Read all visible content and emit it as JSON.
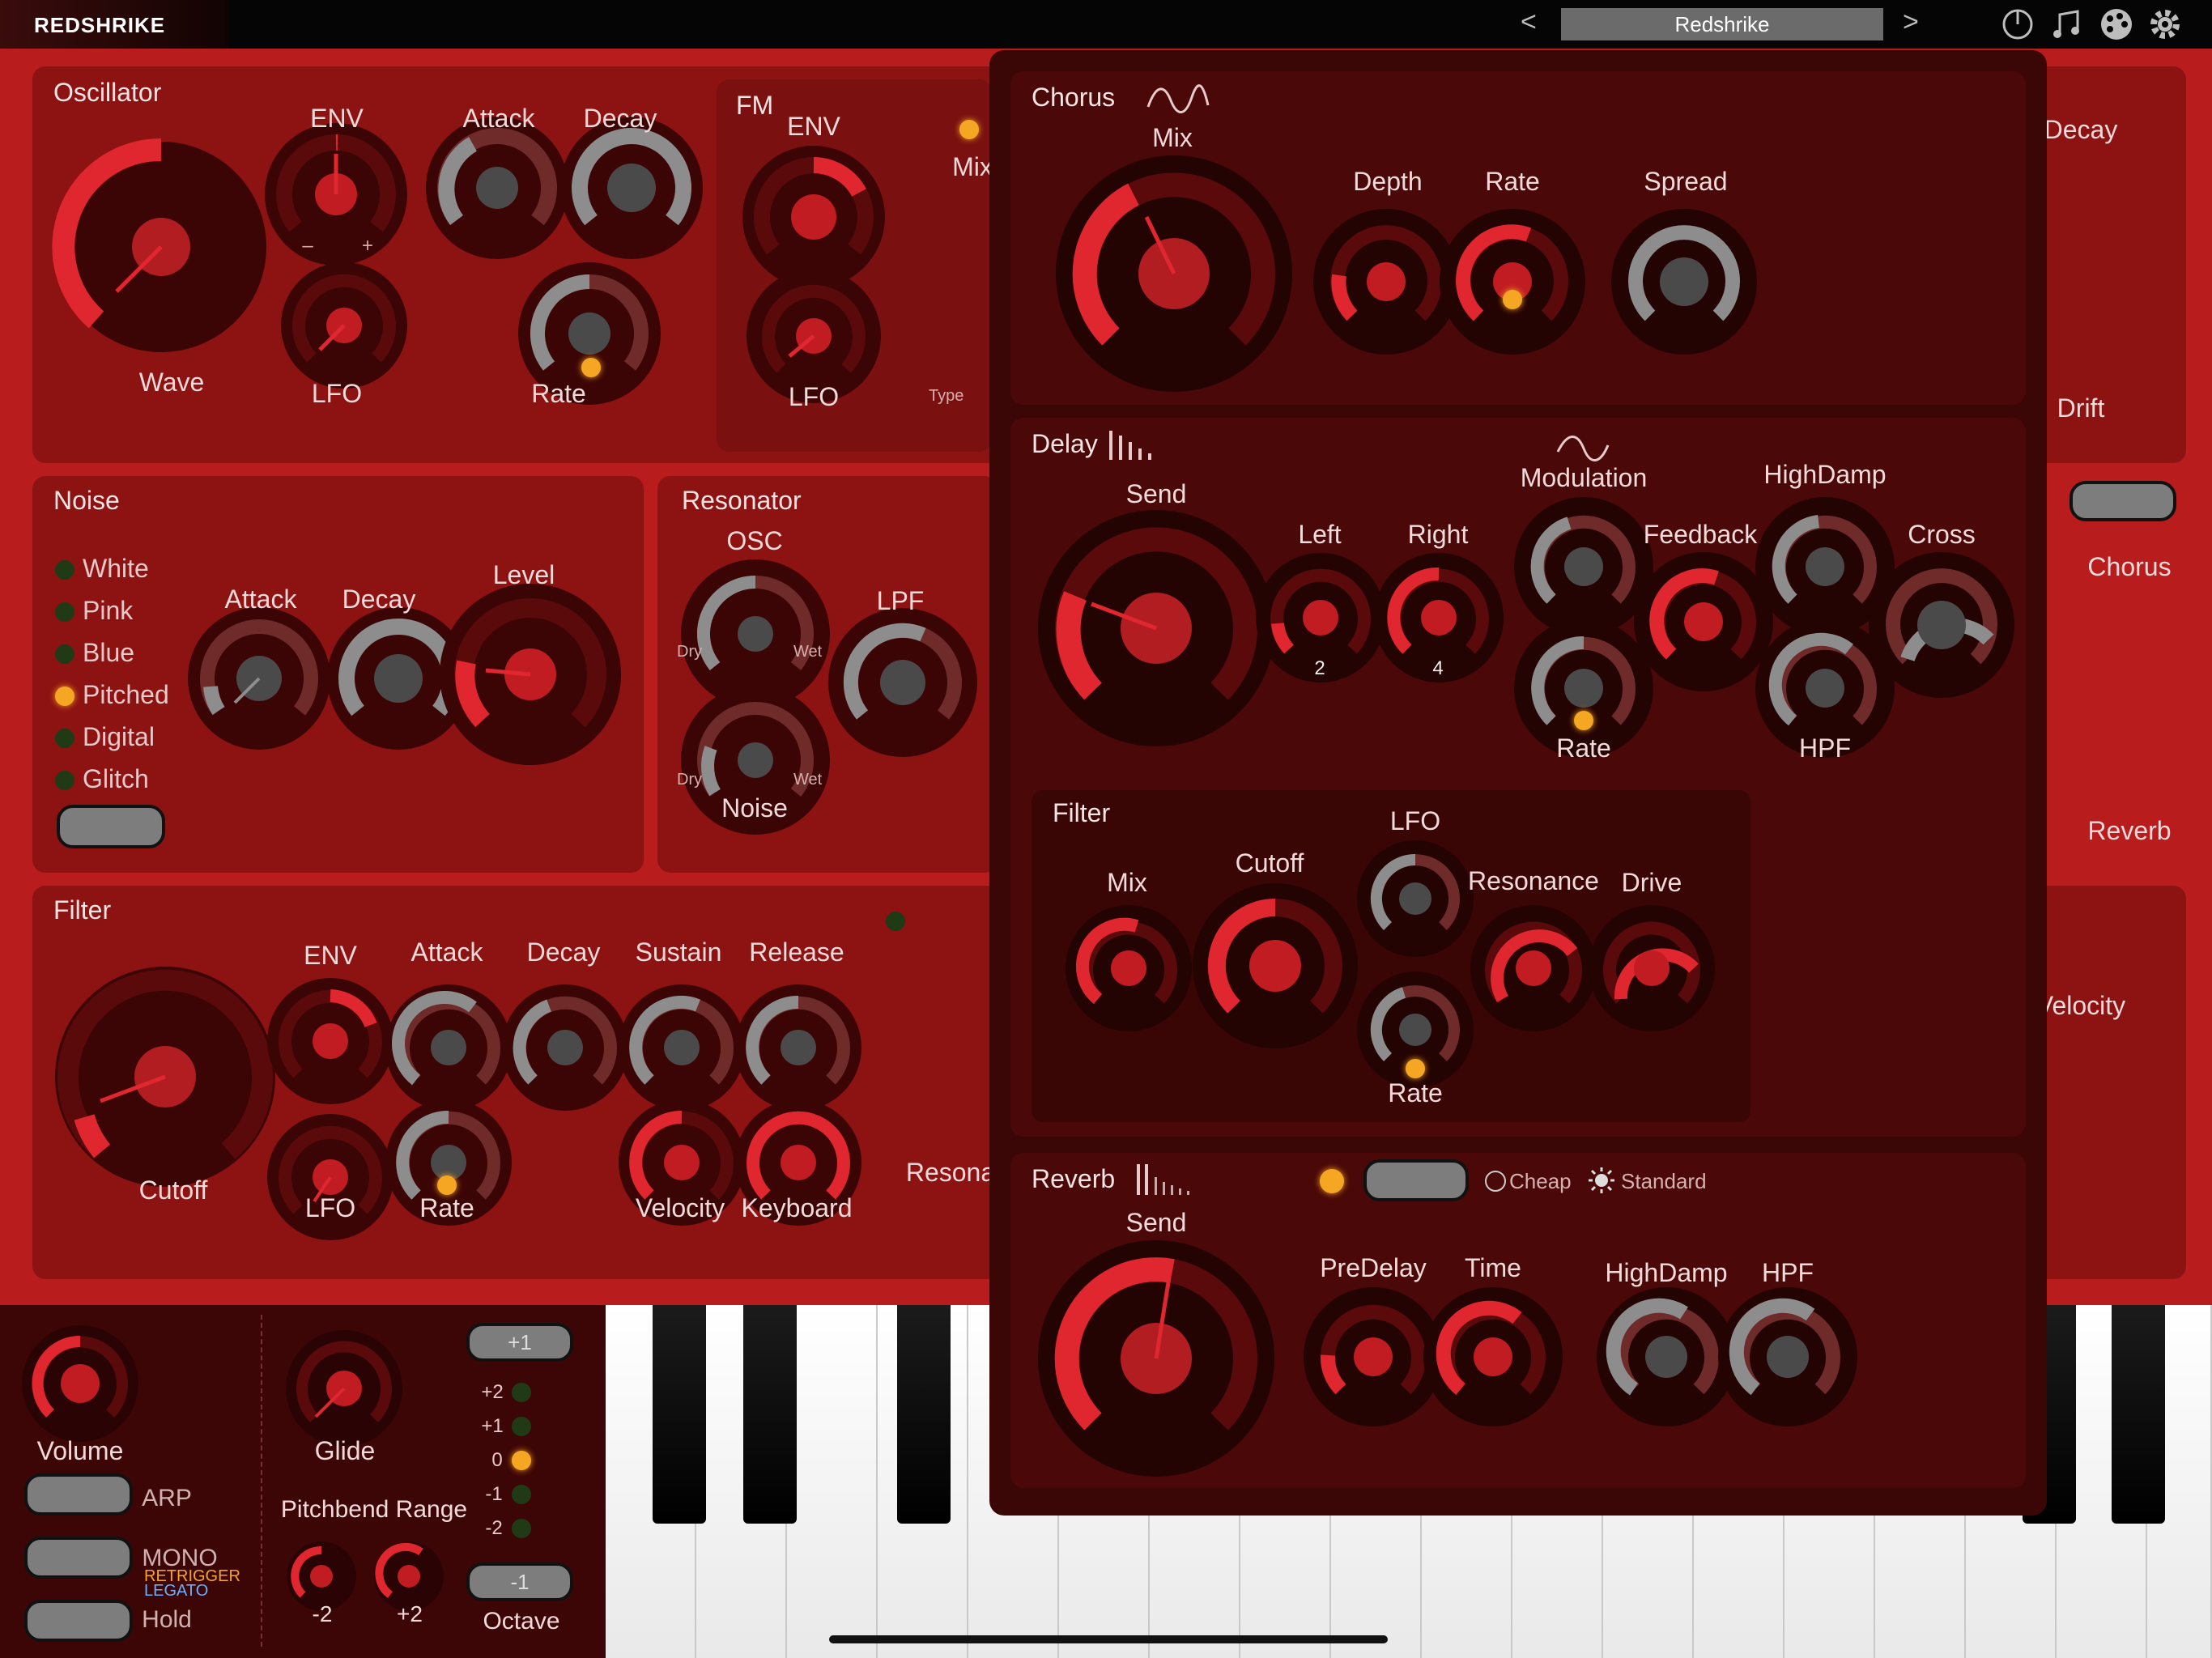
{
  "topbar": {
    "app_name": "REDSHRIKE",
    "preset_name": "Redshrike",
    "prev_label": "<",
    "next_label": ">",
    "icons": [
      "power-icon",
      "music-note-icon",
      "palette-icon",
      "settings-gear-icon"
    ]
  },
  "oscillator": {
    "title": "Oscillator",
    "wave_label": "Wave",
    "env_label": "ENV",
    "lfo_label": "LFO",
    "attack_label": "Attack",
    "decay_label": "Decay",
    "rate_label": "Rate",
    "minus": "–",
    "plus": "+"
  },
  "fm": {
    "title": "FM",
    "env_label": "ENV",
    "lfo_label": "LFO",
    "mix_label": "Mix",
    "type_label": "Type"
  },
  "noise": {
    "title": "Noise",
    "types": [
      "White",
      "Pink",
      "Blue",
      "Pitched",
      "Digital",
      "Glitch"
    ],
    "selected": "Pitched",
    "attack_label": "Attack",
    "decay_label": "Decay",
    "level_label": "Level"
  },
  "resonator": {
    "title": "Resonator",
    "osc_label": "OSC",
    "noise_label": "Noise",
    "lpf_label": "LPF",
    "dry": "Dry",
    "wet": "Wet"
  },
  "filter": {
    "title": "Filter",
    "cutoff_label": "Cutoff",
    "env_label": "ENV",
    "lfo_label": "LFO",
    "attack_label": "Attack",
    "decay_label": "Decay",
    "sustain_label": "Sustain",
    "release_label": "Release",
    "rate_label": "Rate",
    "velocity_label": "Velocity",
    "keyboard_label": "Keyboard",
    "resona_label": "Resona"
  },
  "right_partial": {
    "decay_label": "Decay",
    "drift_label": "Drift",
    "chorus_label": "Chorus",
    "reverb_label": "Reverb",
    "velocity_label": "Velocity"
  },
  "bottom": {
    "volume_label": "Volume",
    "glide_label": "Glide",
    "arp_label": "ARP",
    "mono_label": "MONO",
    "retrigger_label": "RETRIGGER",
    "legato_label": "LEGATO",
    "hold_label": "Hold",
    "pitchbend_label": "Pitchbend Range",
    "pb_down": "-2",
    "pb_up": "+2",
    "octave_label": "Octave",
    "octave_up": "+1",
    "octave_down": "-1",
    "octave_levels": [
      "+2",
      "+1",
      "0",
      "-1",
      "-2"
    ],
    "octave_selected": "0"
  },
  "fx": {
    "chorus": {
      "title": "Chorus",
      "mix_label": "Mix",
      "depth_label": "Depth",
      "rate_label": "Rate",
      "spread_label": "Spread"
    },
    "delay": {
      "title": "Delay",
      "send_label": "Send",
      "left_label": "Left",
      "left_value": "2",
      "right_label": "Right",
      "right_value": "4",
      "modulation_label": "Modulation",
      "rate_label": "Rate",
      "feedback_label": "Feedback",
      "highdamp_label": "HighDamp",
      "hpf_label": "HPF",
      "cross_label": "Cross"
    },
    "delay_filter": {
      "title": "Filter",
      "mix_label": "Mix",
      "cutoff_label": "Cutoff",
      "lfo_label": "LFO",
      "rate_label": "Rate",
      "resonance_label": "Resonance",
      "drive_label": "Drive"
    },
    "reverb": {
      "title": "Reverb",
      "send_label": "Send",
      "predelay_label": "PreDelay",
      "time_label": "Time",
      "highdamp_label": "HighDamp",
      "hpf_label": "HPF",
      "cheap_label": "Cheap",
      "standard_label": "Standard"
    }
  },
  "colors": {
    "accent_red": "#e0262e",
    "panel": "#8d1212",
    "led_on": "#f5a623",
    "grey_arc": "#8a8a8a"
  }
}
